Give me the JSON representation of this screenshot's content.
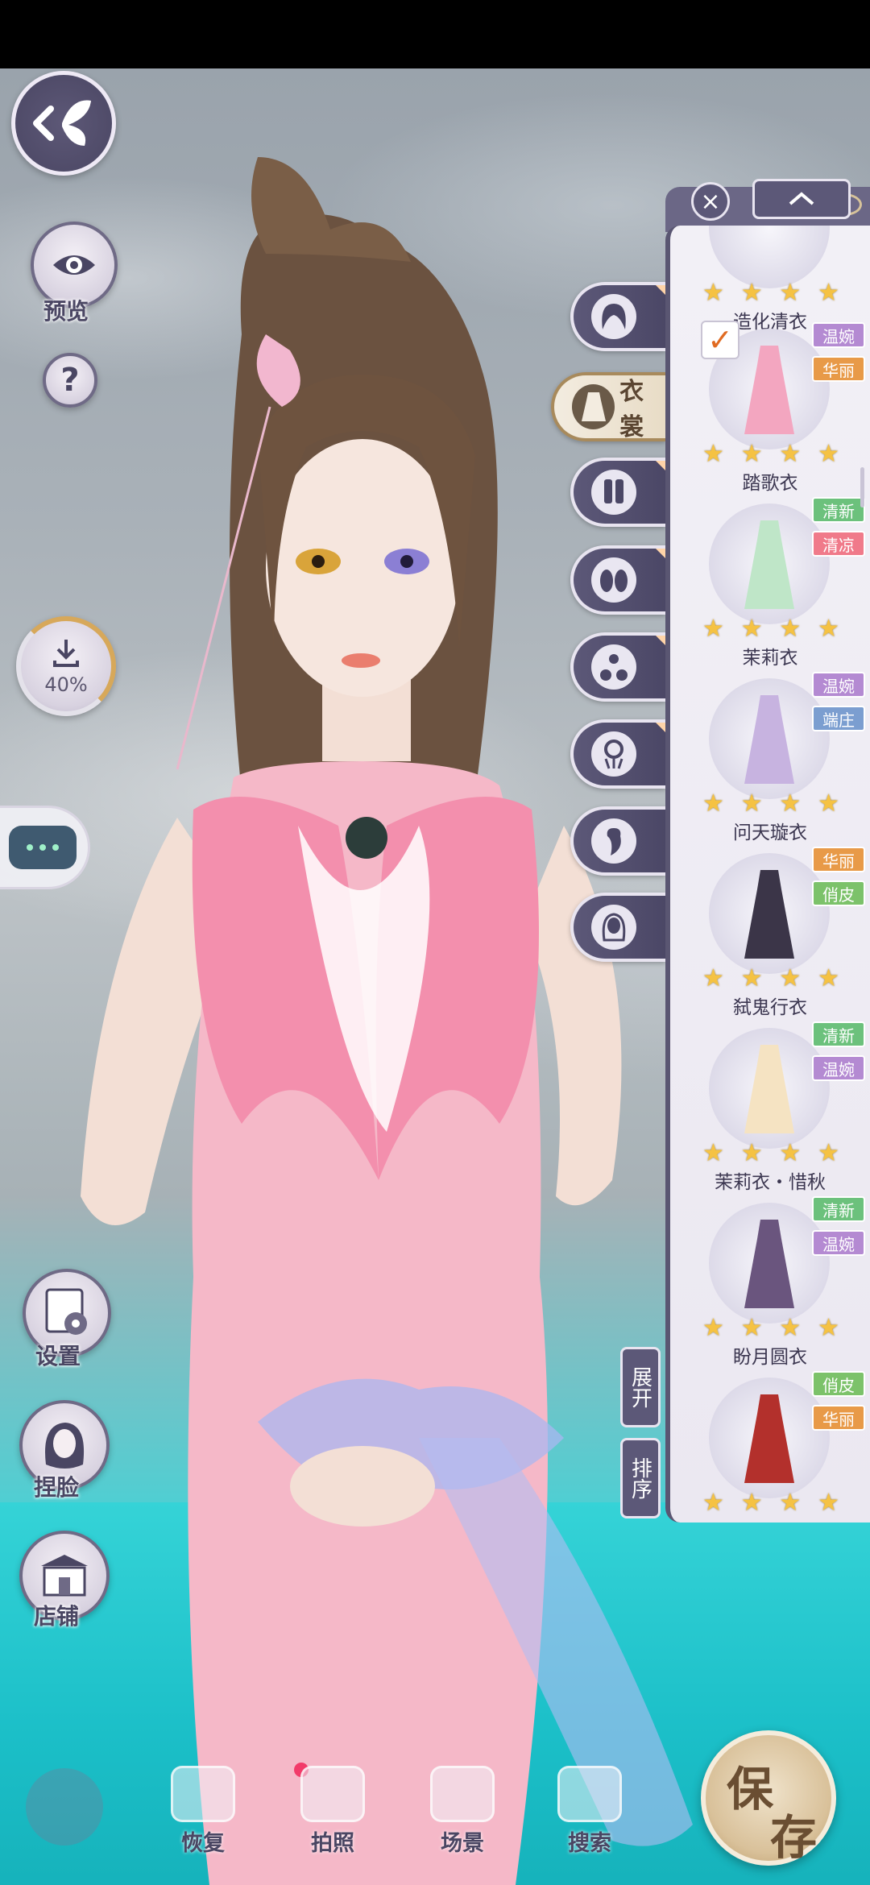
{
  "colors": {
    "panel_bg": "#efedf4",
    "panel_border": "#5a5672",
    "star": "#f5c243",
    "save": "#d9c19a"
  },
  "left": {
    "preview_label": "预览",
    "help_label": "?",
    "download_pct": "40%",
    "settings_label": "设置",
    "face_label": "捏脸",
    "shop_label": "店铺"
  },
  "categories": [
    {
      "icon": "hair-icon"
    },
    {
      "icon": "dress-icon",
      "label": "衣裳",
      "active": true
    },
    {
      "icon": "socks-icon"
    },
    {
      "icon": "shoes-icon"
    },
    {
      "icon": "accessory-icon"
    },
    {
      "icon": "hairpin-icon"
    },
    {
      "icon": "earring-icon"
    },
    {
      "icon": "makeup-icon"
    }
  ],
  "panel": {
    "close_label": "×",
    "collapse_label": "^",
    "expand_label": "展开",
    "sort_label": "排序",
    "items": [
      {
        "name": "造化清衣",
        "tags": []
      },
      {
        "name": "踏歌衣",
        "tags": [
          "温婉",
          "华丽"
        ],
        "selected": true,
        "dress_color": "#f3a6c0"
      },
      {
        "name": "茉莉衣",
        "tags": [
          "清新",
          "清凉"
        ],
        "dress_color": "#bfe6c8"
      },
      {
        "name": "问天璇衣",
        "tags": [
          "温婉",
          "端庄"
        ],
        "dress_color": "#c7b3e0"
      },
      {
        "name": "弑鬼行衣",
        "tags": [
          "华丽",
          "俏皮"
        ],
        "dress_color": "#3b3548"
      },
      {
        "name": "茉莉衣・惜秋",
        "tags": [
          "清新",
          "温婉"
        ],
        "dress_color": "#f5e3c2"
      },
      {
        "name": "盼月圆衣",
        "tags": [
          "清新",
          "温婉"
        ],
        "dress_color": "#6a557e"
      },
      {
        "name": "",
        "tags": [
          "俏皮",
          "华丽"
        ],
        "dress_color": "#b3302c"
      }
    ]
  },
  "tag_colors": {
    "温婉": "#b48ad2",
    "华丽": "#e89a48",
    "清新": "#6cc17c",
    "清凉": "#f07a8a",
    "端庄": "#7b9ed0",
    "俏皮": "#7cc26a"
  },
  "bottom": {
    "restore_label": "恢复",
    "photo_label": "拍照",
    "scene_label": "场景",
    "search_label": "搜索",
    "save_label_1": "保",
    "save_label_2": "存"
  }
}
